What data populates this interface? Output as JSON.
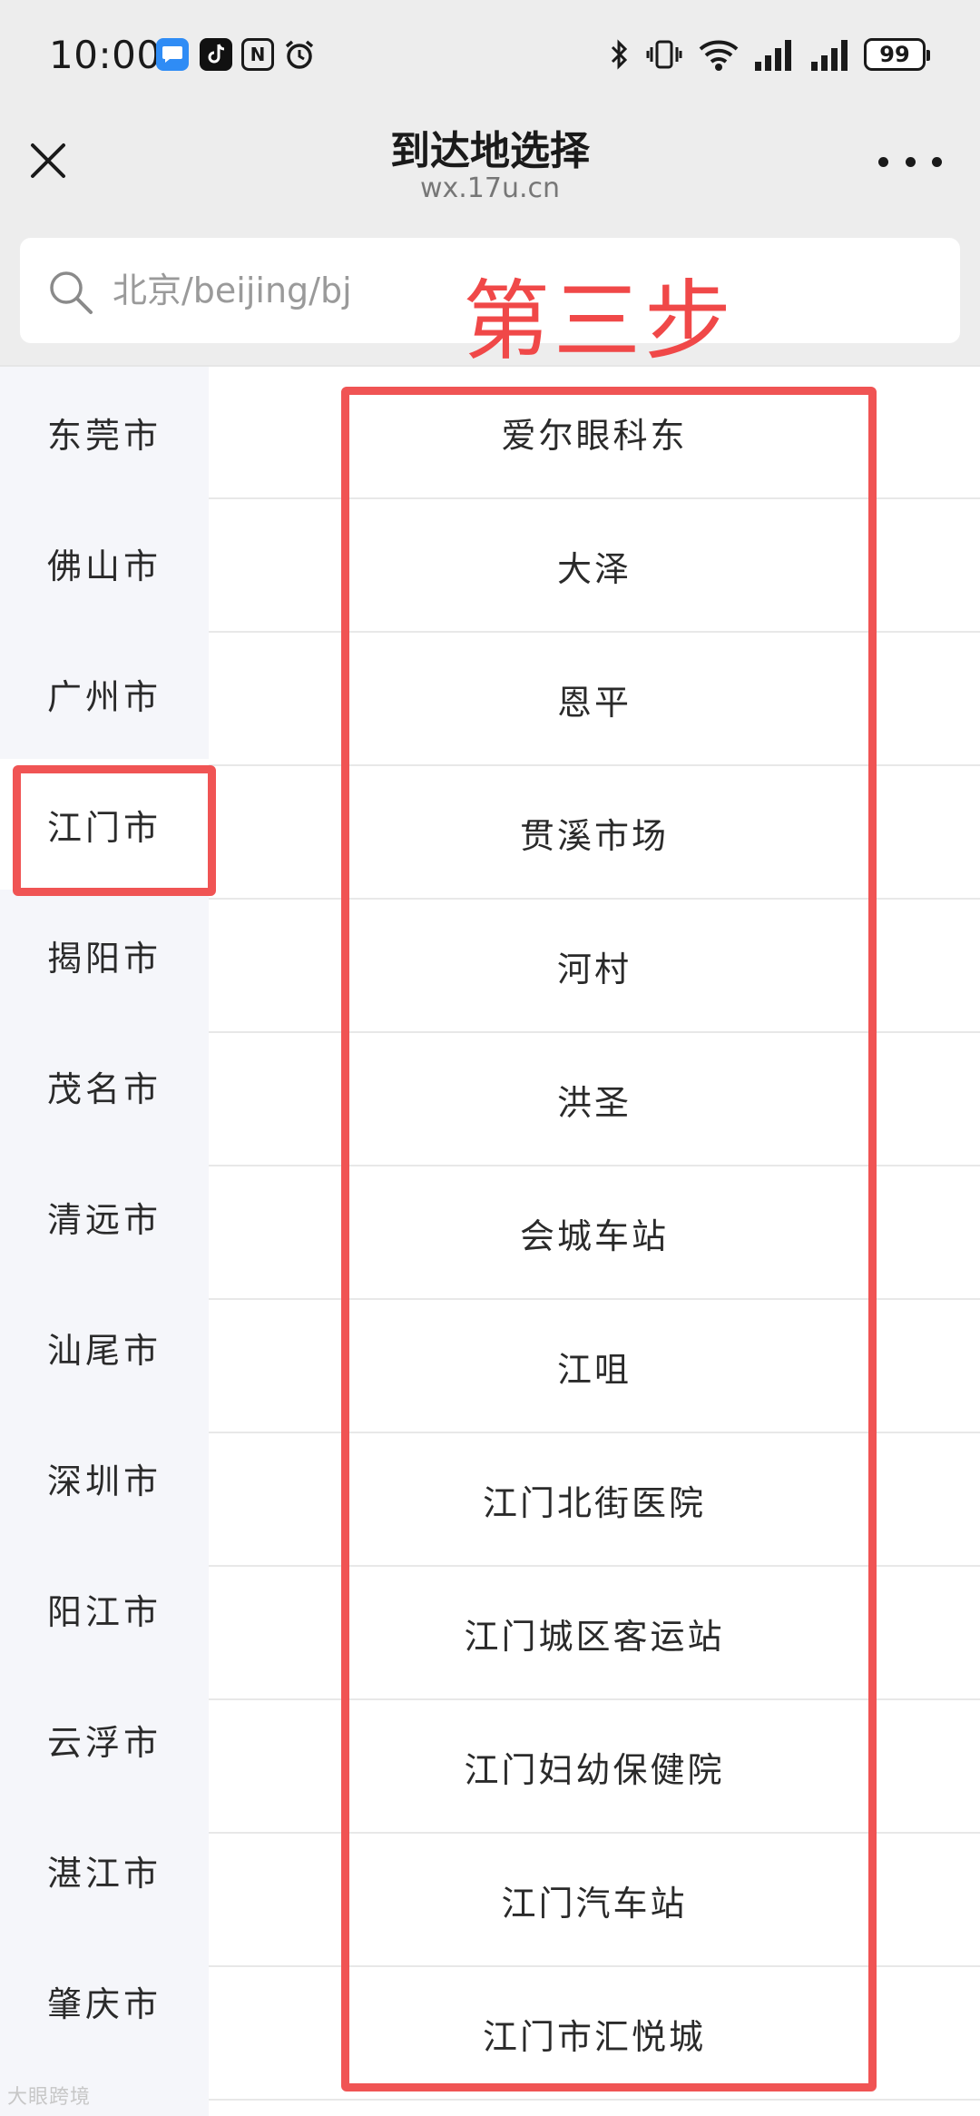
{
  "status_bar": {
    "time": "10:00",
    "battery": "99",
    "icons": [
      "message-app-icon",
      "tiktok-icon",
      "nfc-icon",
      "alarm-icon",
      "bluetooth-icon",
      "vibrate-icon",
      "wifi-icon",
      "signal-icon",
      "signal-icon",
      "battery-icon"
    ]
  },
  "header": {
    "title": "到达地选择",
    "subtitle": "wx.17u.cn",
    "close_icon": "close-icon",
    "more_icon": "more-dots-icon"
  },
  "search": {
    "placeholder": "北京/beijing/bj",
    "value": ""
  },
  "annotation": {
    "text": "第三步",
    "color": "#f04848"
  },
  "sidebar": {
    "items": [
      {
        "label": "东莞市"
      },
      {
        "label": "佛山市"
      },
      {
        "label": "广州市"
      },
      {
        "label": "江门市",
        "active": true
      },
      {
        "label": "揭阳市"
      },
      {
        "label": "茂名市"
      },
      {
        "label": "清远市"
      },
      {
        "label": "汕尾市"
      },
      {
        "label": "深圳市"
      },
      {
        "label": "阳江市"
      },
      {
        "label": "云浮市"
      },
      {
        "label": "湛江市"
      },
      {
        "label": "肇庆市"
      }
    ]
  },
  "stations": {
    "items": [
      {
        "label": "爱尔眼科东"
      },
      {
        "label": "大泽"
      },
      {
        "label": "恩平"
      },
      {
        "label": "贯溪市场"
      },
      {
        "label": "河村"
      },
      {
        "label": "洪圣"
      },
      {
        "label": "会城车站"
      },
      {
        "label": "江咀"
      },
      {
        "label": "江门北街医院"
      },
      {
        "label": "江门城区客运站"
      },
      {
        "label": "江门妇幼保健院"
      },
      {
        "label": "江门汽车站"
      },
      {
        "label": "江门市汇悦城"
      }
    ]
  },
  "highlight_color": "#f05454",
  "watermark": "大眼跨境"
}
